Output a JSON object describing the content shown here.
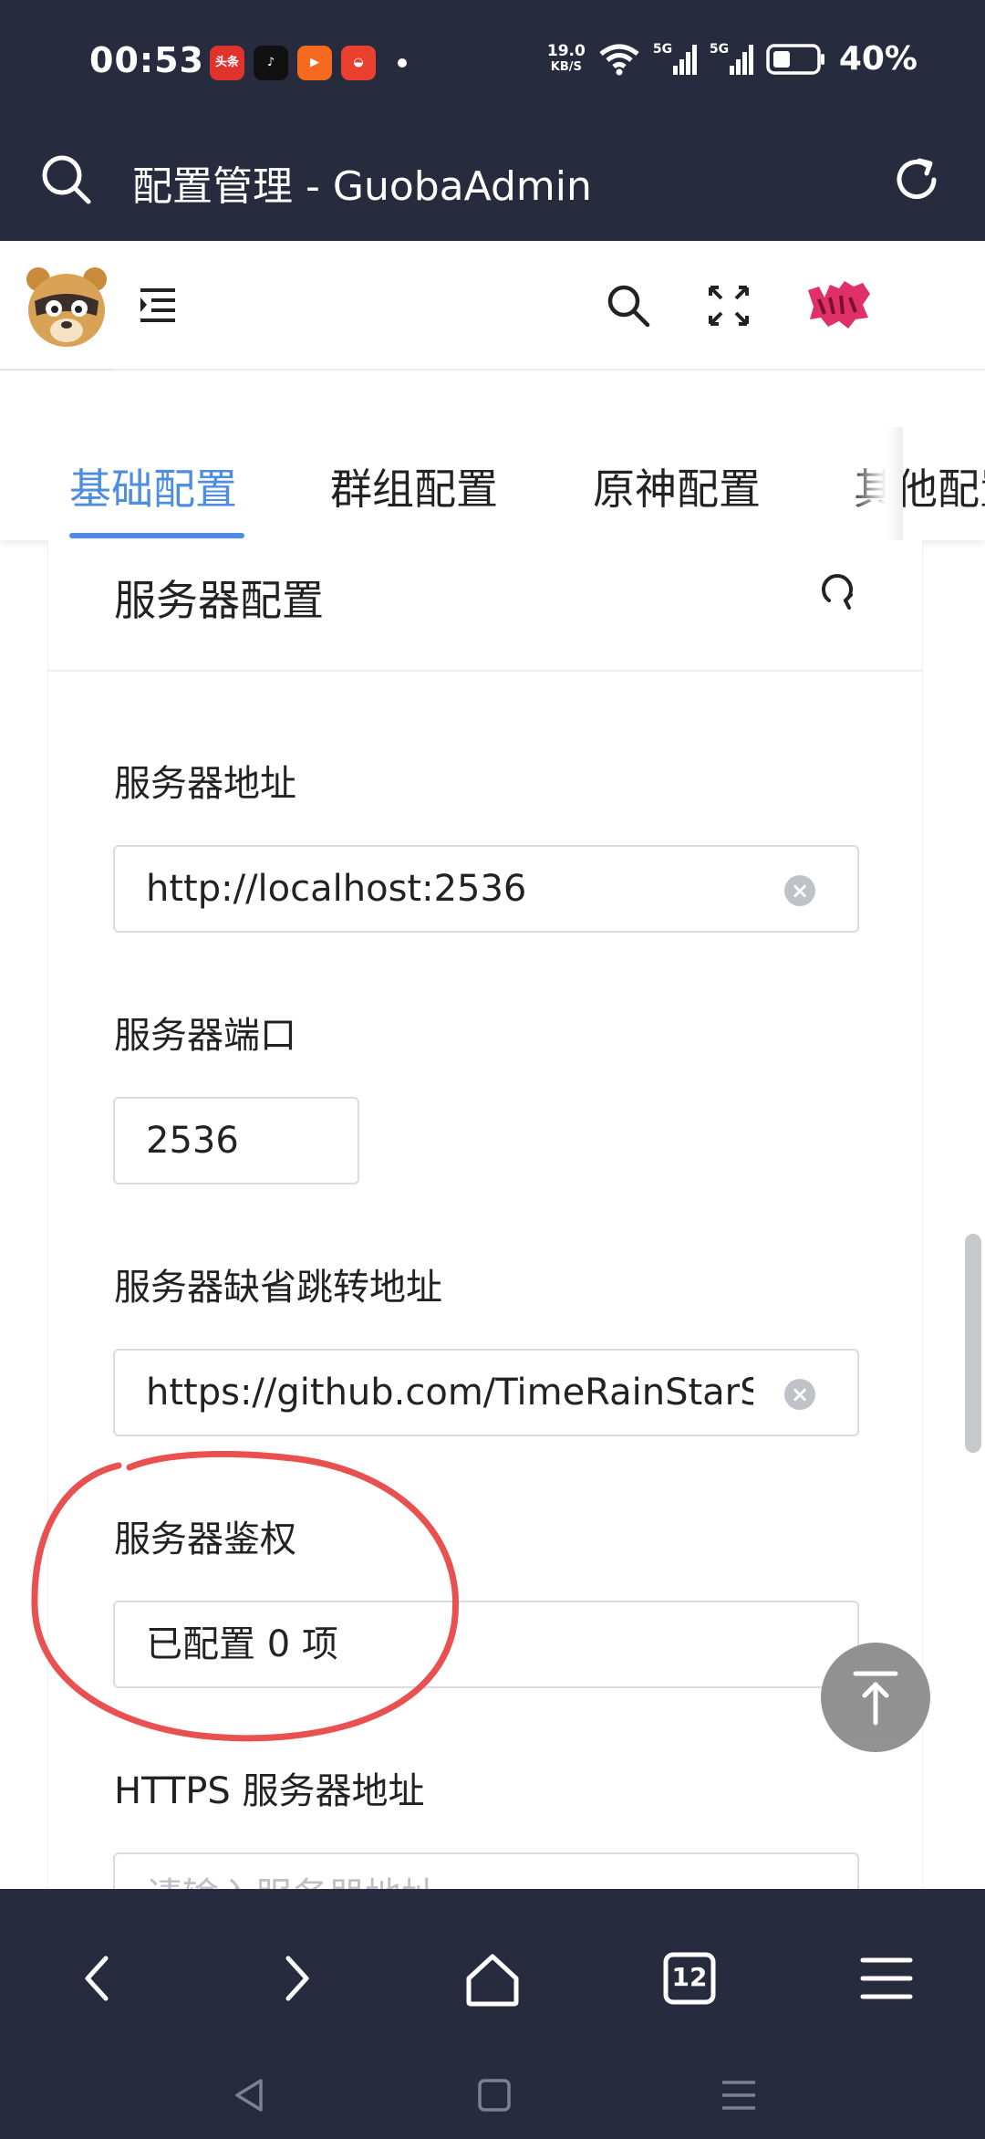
{
  "status_bar": {
    "time": "00:53",
    "net_speed_value": "19.0",
    "net_speed_unit": "KB/S",
    "signal_1": "5G",
    "signal_2": "5G",
    "battery": "40%",
    "app_icons": [
      "toutiao-icon",
      "tiktok-icon",
      "kuaishou-lite-icon",
      "red-app-icon"
    ]
  },
  "browser": {
    "page_title": "配置管理 - GuobaAdmin",
    "tab_count": "12"
  },
  "tabs": [
    {
      "label": "基础配置",
      "active": true
    },
    {
      "label": "群组配置",
      "active": false
    },
    {
      "label": "原神配置",
      "active": false
    },
    {
      "label": "其他配置",
      "active": false
    }
  ],
  "card": {
    "title": "服务器配置"
  },
  "form": {
    "server_address": {
      "label": "服务器地址",
      "value": "http://localhost:2536"
    },
    "server_port": {
      "label": "服务器端口",
      "value": "2536"
    },
    "default_redirect": {
      "label": "服务器缺省跳转地址",
      "value": "https://github.com/TimeRainStarSky"
    },
    "server_auth": {
      "label": "服务器鉴权",
      "value": "已配置 0 项"
    },
    "https_address": {
      "label": "HTTPS 服务器地址",
      "placeholder": "请输入服务器地址"
    }
  },
  "colors": {
    "bar_bg": "#262c3d",
    "accent": "#4d8ee0",
    "annotation": "#e8514f"
  }
}
